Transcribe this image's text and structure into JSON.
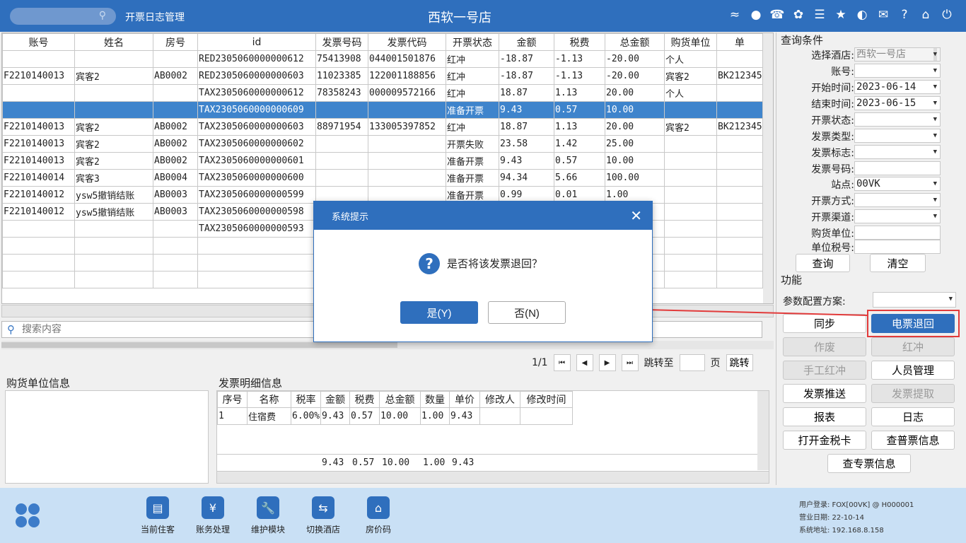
{
  "topbar": {
    "module": "开票日志管理",
    "store_title": "西软一号店",
    "icons": [
      "wifi-icon",
      "chat-icon",
      "phone-icon",
      "palette-icon",
      "menu-icon",
      "star-icon",
      "theme-icon",
      "mail-icon",
      "help-icon",
      "home-icon",
      "power-icon"
    ]
  },
  "grid": {
    "columns": [
      "账号",
      "姓名",
      "房号",
      "id",
      "发票号码",
      "发票代码",
      "开票状态",
      "金额",
      "税费",
      "总金额",
      "购货单位",
      "单"
    ],
    "rows": [
      [
        "",
        "",
        "",
        "RED2305060000000612",
        "75413908",
        "044001501876",
        "红冲",
        "-18.87",
        "-1.13",
        "-20.00",
        "个人",
        ""
      ],
      [
        "F2210140013",
        "宾客2",
        "AB0002",
        "RED2305060000000603",
        "11023385",
        "122001188856",
        "红冲",
        "-18.87",
        "-1.13",
        "-20.00",
        "宾客2",
        "BK212345"
      ],
      [
        "",
        "",
        "",
        "TAX2305060000000612",
        "78358243",
        "000009572166",
        "红冲",
        "18.87",
        "1.13",
        "20.00",
        "个人",
        ""
      ],
      [
        "",
        "",
        "",
        "TAX2305060000000609",
        "",
        "",
        "准备开票",
        "9.43",
        "0.57",
        "10.00",
        "",
        ""
      ],
      [
        "F2210140013",
        "宾客2",
        "AB0002",
        "TAX2305060000000603",
        "88971954",
        "133005397852",
        "红冲",
        "18.87",
        "1.13",
        "20.00",
        "宾客2",
        "BK212345"
      ],
      [
        "F2210140013",
        "宾客2",
        "AB0002",
        "TAX2305060000000602",
        "",
        "",
        "开票失败",
        "23.58",
        "1.42",
        "25.00",
        "",
        ""
      ],
      [
        "F2210140013",
        "宾客2",
        "AB0002",
        "TAX2305060000000601",
        "",
        "",
        "准备开票",
        "9.43",
        "0.57",
        "10.00",
        "",
        ""
      ],
      [
        "F2210140014",
        "宾客3",
        "AB0004",
        "TAX2305060000000600",
        "",
        "",
        "准备开票",
        "94.34",
        "5.66",
        "100.00",
        "",
        ""
      ],
      [
        "F2210140012",
        "ysw5撤销结账",
        "AB0003",
        "TAX2305060000000599",
        "",
        "",
        "准备开票",
        "0.99",
        "0.01",
        "1.00",
        "",
        ""
      ],
      [
        "F2210140012",
        "ysw5撤销结账",
        "AB0003",
        "TAX2305060000000598",
        "",
        "",
        "",
        "",
        "",
        "",
        "",
        ""
      ],
      [
        "",
        "",
        "",
        "TAX2305060000000593",
        "",
        "",
        "",
        "",
        "",
        "",
        "",
        ""
      ]
    ],
    "selected_row": 3
  },
  "search": {
    "placeholder": "搜索内容"
  },
  "pager": {
    "page": "1/1",
    "jump_to": "跳转至",
    "page_unit": "页",
    "jump_button": "跳转"
  },
  "buyer_panel": {
    "title": "购货单位信息"
  },
  "detail_panel": {
    "title": "发票明细信息",
    "columns": [
      "序号",
      "名称",
      "税率",
      "金额",
      "税费",
      "总金额",
      "数量",
      "单价",
      "修改人",
      "修改时间"
    ],
    "rows": [
      [
        "1",
        "住宿费",
        "6.00%",
        "9.43",
        "0.57",
        "10.00",
        "1.00",
        "9.43",
        "",
        ""
      ]
    ],
    "totals": {
      "amount": "9.43",
      "tax": "0.57",
      "total": "10.00",
      "qty": "1.00",
      "price": "9.43"
    }
  },
  "query": {
    "title": "查询条件",
    "fields": [
      {
        "label": "选择酒店:",
        "value": "西软一号店"
      },
      {
        "label": "账号:",
        "value": ""
      },
      {
        "label": "开始时间:",
        "value": "2023-06-14"
      },
      {
        "label": "结束时间:",
        "value": "2023-06-15"
      },
      {
        "label": "开票状态:",
        "value": ""
      },
      {
        "label": "发票类型:",
        "value": ""
      },
      {
        "label": "发票标志:",
        "value": ""
      },
      {
        "label": "发票号码:",
        "value": ""
      },
      {
        "label": "站点:",
        "value": "00VK"
      },
      {
        "label": "开票方式:",
        "value": ""
      },
      {
        "label": "开票渠道:",
        "value": ""
      },
      {
        "label": "购货单位:",
        "value": ""
      },
      {
        "label": "单位税号:",
        "value": ""
      }
    ],
    "query_button": "查询",
    "clear_button": "清空"
  },
  "functions": {
    "title": "功能",
    "config_label": "参数配置方案:",
    "config_value": "",
    "buttons": [
      "同步",
      "电票退回",
      "作废",
      "红冲",
      "手工红冲",
      "人员管理",
      "发票推送",
      "发票提取",
      "报表",
      "日志",
      "打开金税卡",
      "查普票信息",
      "查专票信息"
    ]
  },
  "dialog": {
    "title": "系统提示",
    "message": "是否将该发票退回？",
    "yes_label": "是(Y)",
    "no_label": "否(N)"
  },
  "taskbar": {
    "items": [
      "当前住客",
      "账务处理",
      "维护模块",
      "切换酒店",
      "房价码"
    ],
    "info": {
      "user": "用户登录:  FOX[00VK] @ H000001",
      "date": "营业日期:  22-10-14",
      "address": "系统地址:  192.168.8.158"
    }
  },
  "colors": {
    "accent": "#2f6fbd",
    "highlight": "#e23b3b",
    "selected_row": "#3e84cc"
  }
}
